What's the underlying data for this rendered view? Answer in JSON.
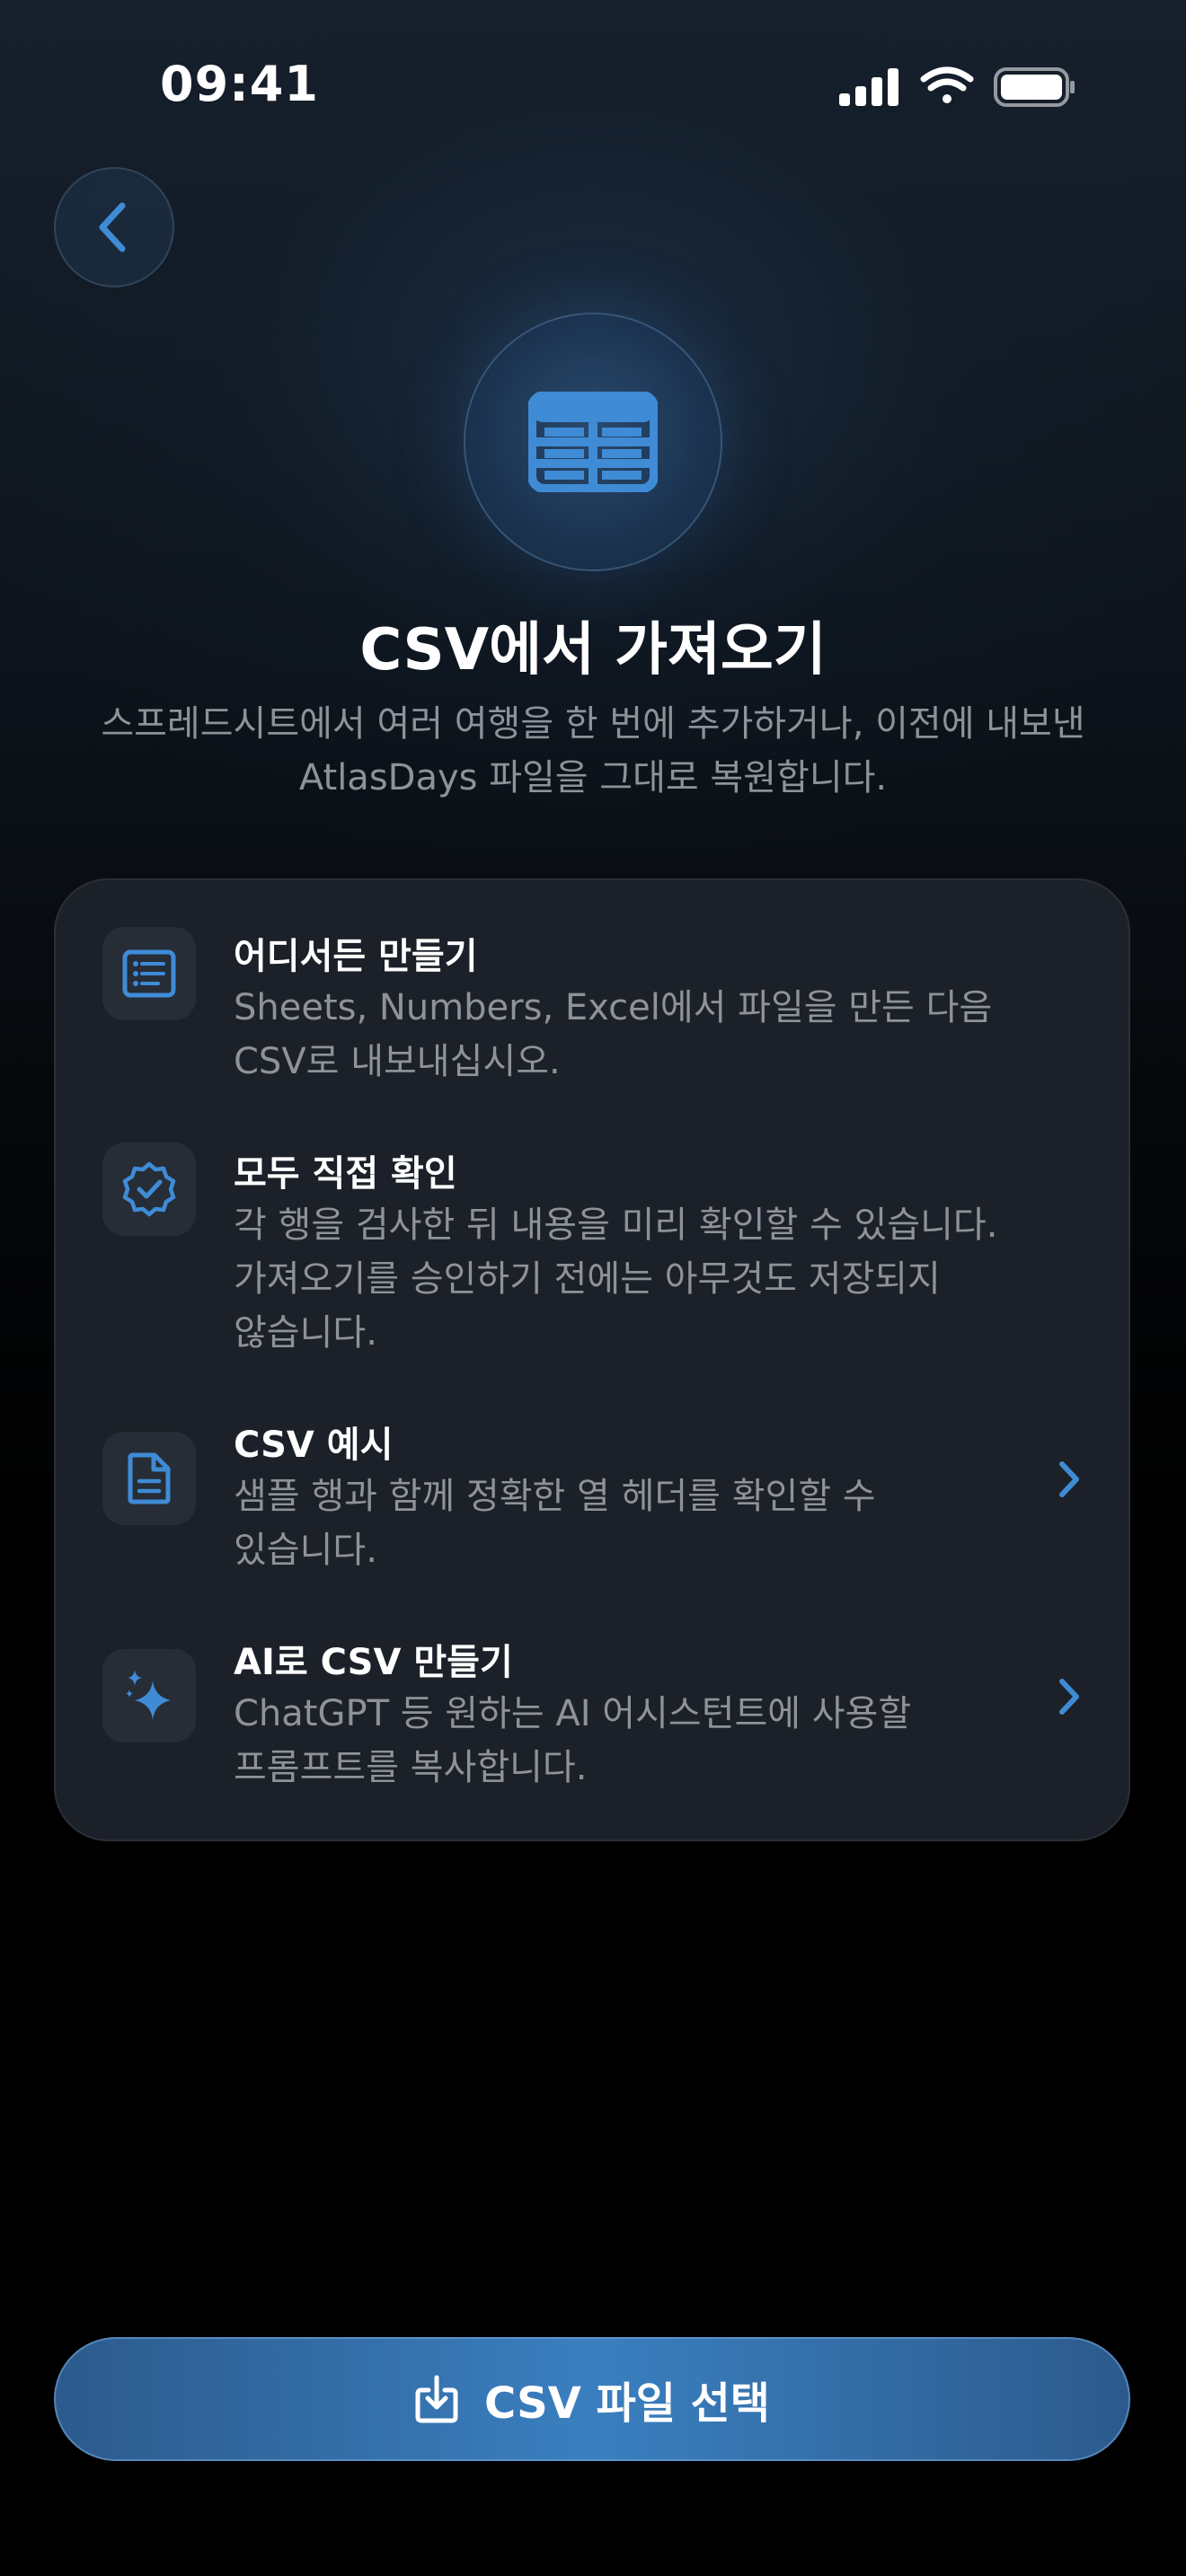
{
  "status_bar": {
    "time": "09:41",
    "signal_icon": "cellular-signal-icon",
    "wifi_icon": "wifi-icon",
    "battery_icon": "battery-icon"
  },
  "nav": {
    "back_icon": "chevron-left-icon"
  },
  "header": {
    "hero_icon": "table-icon",
    "title": "CSV에서 가져오기",
    "subtitle_line1": "스프레드시트에서 여러 여행을 한 번에 추가하거나, 이전에 내보낸",
    "subtitle_line2": "AtlasDays 파일을 그대로 복원합니다."
  },
  "features": [
    {
      "icon": "list-document-icon",
      "title": "어디서든 만들기",
      "desc_lines": [
        "Sheets, Numbers, Excel에서 파일을 만든 다음",
        "CSV로 내보내십시오."
      ],
      "has_chevron": false
    },
    {
      "icon": "verified-badge-icon",
      "title": "모두 직접 확인",
      "desc_lines": [
        "각 행을 검사한 뒤 내용을 미리 확인할 수 있습니다.",
        "가져오기를 승인하기 전에는 아무것도 저장되지",
        "않습니다."
      ],
      "has_chevron": false
    },
    {
      "icon": "file-icon",
      "title": "CSV 예시",
      "desc_lines": [
        "샘플 행과 함께 정확한 열 헤더를 확인할 수",
        "있습니다."
      ],
      "has_chevron": true
    },
    {
      "icon": "sparkles-icon",
      "title": "AI로 CSV 만들기",
      "desc_lines": [
        "ChatGPT 등 원하는 AI 어시스턴트에 사용할",
        "프롬프트를 복사합니다."
      ],
      "has_chevron": true
    }
  ],
  "cta": {
    "icon": "import-icon",
    "label": "CSV 파일 선택"
  },
  "colors": {
    "accent": "#3f8bd6",
    "card_bg": "#1c2028",
    "text_secondary": "#8e9299"
  }
}
